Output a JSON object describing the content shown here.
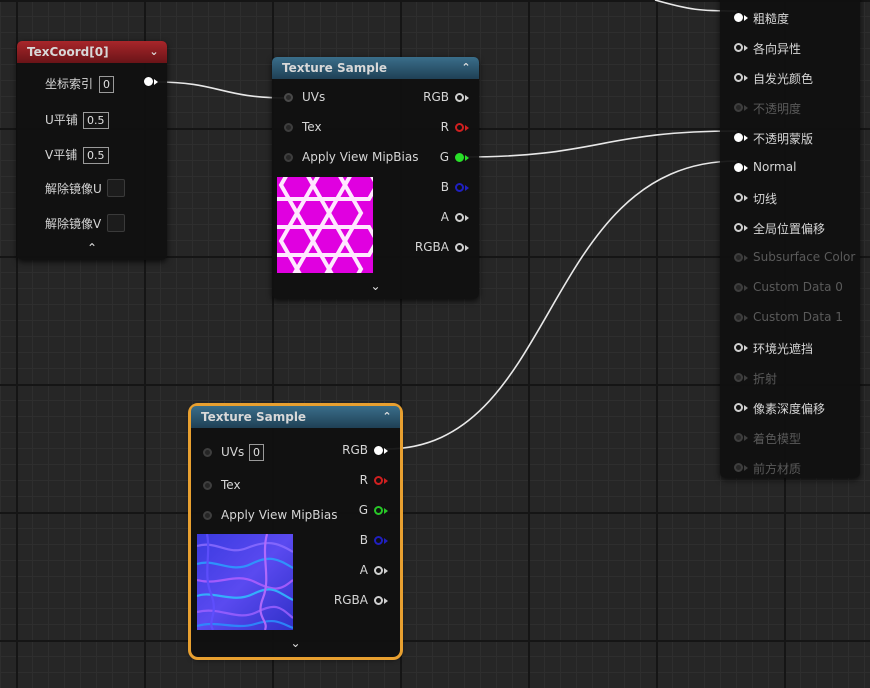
{
  "texcoord": {
    "title": "TexCoord[0]",
    "rows": [
      {
        "label": "坐标索引",
        "value": "0"
      },
      {
        "label": "U平铺",
        "value": "0.5"
      },
      {
        "label": "V平铺",
        "value": "0.5"
      },
      {
        "label": "解除镜像U"
      },
      {
        "label": "解除镜像V"
      }
    ]
  },
  "texsample1": {
    "title": "Texture Sample",
    "inputs": [
      "UVs",
      "Tex",
      "Apply View MipBias"
    ],
    "outputs": [
      "RGB",
      "R",
      "G",
      "B",
      "A",
      "RGBA"
    ]
  },
  "texsample2": {
    "title": "Texture Sample",
    "inputs": [
      "UVs",
      "Tex",
      "Apply View MipBias"
    ],
    "uvs_value": "0",
    "outputs": [
      "RGB",
      "R",
      "G",
      "B",
      "A",
      "RGBA"
    ]
  },
  "material": {
    "pins": [
      {
        "label": "粗糙度",
        "state": "connected"
      },
      {
        "label": "各向异性",
        "state": "active"
      },
      {
        "label": "自发光颜色",
        "state": "active"
      },
      {
        "label": "不透明度",
        "state": "disabled"
      },
      {
        "label": "不透明蒙版",
        "state": "connected"
      },
      {
        "label": "Normal",
        "state": "connected"
      },
      {
        "label": "切线",
        "state": "active"
      },
      {
        "label": "全局位置偏移",
        "state": "active"
      },
      {
        "label": "Subsurface Color",
        "state": "disabled"
      },
      {
        "label": "Custom Data 0",
        "state": "disabled"
      },
      {
        "label": "Custom Data 1",
        "state": "disabled"
      },
      {
        "label": "环境光遮挡",
        "state": "active"
      },
      {
        "label": "折射",
        "state": "disabled"
      },
      {
        "label": "像素深度偏移",
        "state": "active"
      },
      {
        "label": "着色模型",
        "state": "disabled"
      },
      {
        "label": "前方材质",
        "state": "disabled"
      }
    ]
  },
  "colors": {
    "wire": "#e8e8e8",
    "selection": "#e8a030",
    "header_red": "#a8262a",
    "header_blue": "#3a6e8a",
    "pin_r": "#d02020",
    "pin_g": "#28e028",
    "pin_b": "#2020c0"
  }
}
